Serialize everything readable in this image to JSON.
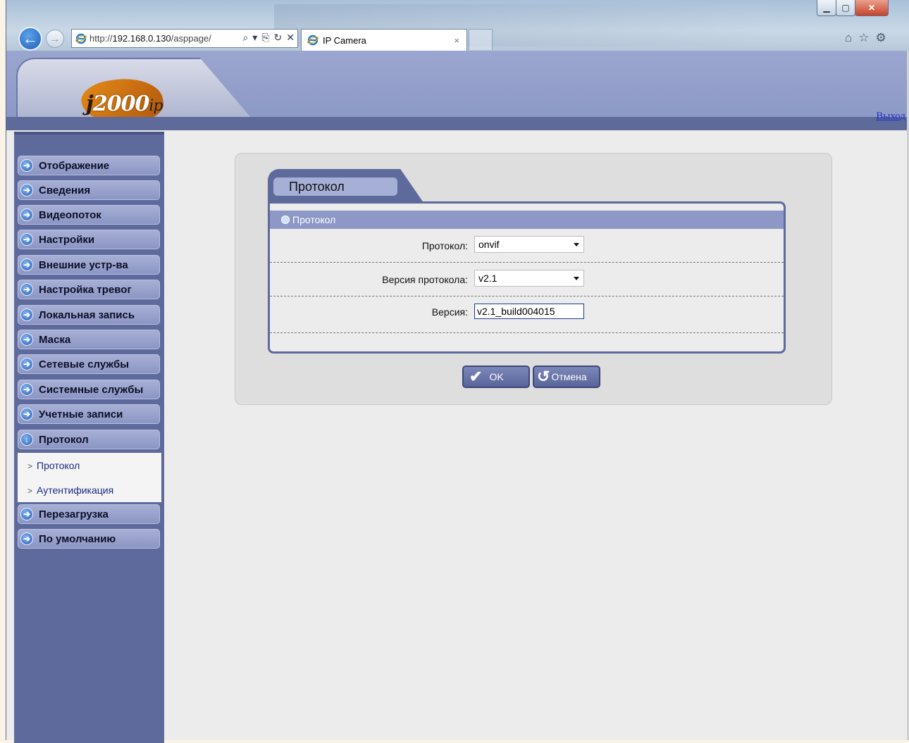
{
  "browser": {
    "url_prefix": "http://",
    "url_host": "192.168.0.130",
    "url_path": "/asppage/",
    "tab_title": "IP Camera",
    "tab_close": "×",
    "window_min": "▁",
    "window_max": "▢",
    "window_close": "✕",
    "icons": [
      "back-arrow-icon",
      "forward-arrow-icon",
      "search-icon",
      "compat-icon",
      "refresh-icon",
      "stop-icon",
      "home-icon",
      "favorites-icon",
      "settings-icon"
    ]
  },
  "header": {
    "logo_text_j": "j",
    "logo_text_num": "2000",
    "logo_text_ip": "ip",
    "logout": "Выход"
  },
  "sidebar": {
    "items": [
      {
        "label": "Отображение"
      },
      {
        "label": "Сведения"
      },
      {
        "label": "Видеопоток"
      },
      {
        "label": "Настройки"
      },
      {
        "label": "Внешние устр-ва"
      },
      {
        "label": "Настройка тревог"
      },
      {
        "label": "Локальная запись"
      },
      {
        "label": "Маска"
      },
      {
        "label": "Сетевые службы"
      },
      {
        "label": "Системные службы"
      },
      {
        "label": "Учетные записи"
      },
      {
        "label": "Протокол"
      },
      {
        "label": "Перезагрузка"
      },
      {
        "label": "По умолчанию"
      }
    ],
    "subitems": [
      {
        "label": "Протокол"
      },
      {
        "label": "Аутентификация"
      }
    ]
  },
  "panel": {
    "tab_title": "Протокол",
    "section_title": "Протокол",
    "fields": [
      {
        "label": "Протокол:",
        "value": "onvif",
        "type": "select"
      },
      {
        "label": "Версия протокола:",
        "value": "v2.1",
        "type": "select"
      },
      {
        "label": "Версия:",
        "value": "v2.1_build004015",
        "type": "input"
      }
    ],
    "ok_label": "OK",
    "cancel_label": "Отмена"
  },
  "colors": {
    "sidebar_bg": "#5e6a9b",
    "header_bg": "#9aa6cf",
    "accent": "#5f6a9c",
    "link": "#2230c8"
  }
}
